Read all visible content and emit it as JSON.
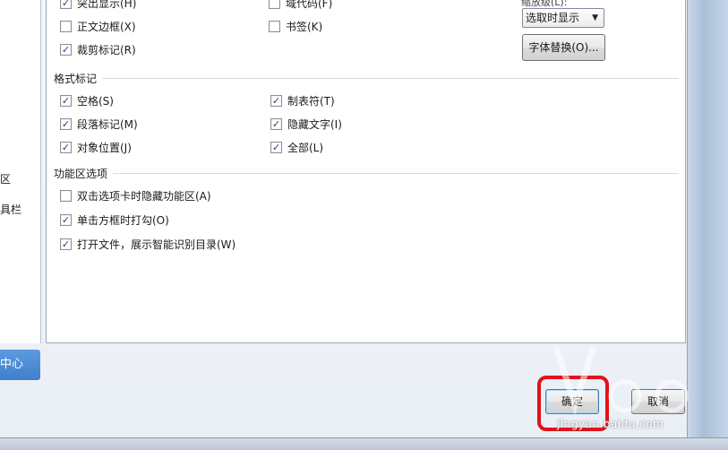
{
  "display_options": {
    "highlight": "突出显示(H)",
    "field_codes": "域代码(F)",
    "text_border": "正文边框(X)",
    "bookmarks": "书签(K)",
    "crop_marks": "裁剪标记(R)",
    "zoom_label": "缩放级(L):",
    "zoom_value": "选取时显示",
    "font_replace": "字体替换(O)..."
  },
  "format_marks": {
    "title": "格式标记",
    "spaces": "空格(S)",
    "tabs": "制表符(T)",
    "paragraph_marks": "段落标记(M)",
    "hidden_text": "隐藏文字(I)",
    "object_anchors": "对象位置(J)",
    "all": "全部(L)"
  },
  "ribbon_options": {
    "title": "功能区选项",
    "hide_on_double_click": "双击选项卡时隐藏功能区(A)",
    "click_box_check": "单击方框时打勾(O)",
    "open_file_show_toc": "打开文件，展示智能识别目录(W)"
  },
  "nav": {
    "item_a": "区",
    "item_b": "具栏",
    "center_button": "中心"
  },
  "buttons": {
    "ok": "确定",
    "cancel": "取消"
  },
  "watermark": {
    "text": "jingyan.baidu.com"
  },
  "checkboxes": {
    "highlight": true,
    "field_codes": false,
    "text_border": false,
    "bookmarks": false,
    "crop_marks": true,
    "spaces": true,
    "tabs": true,
    "paragraph_marks": true,
    "hidden_text": true,
    "object_anchors": true,
    "all": true,
    "hide_on_double_click": false,
    "click_box_check": true,
    "open_file_show_toc": true
  },
  "colors": {
    "highlight_box": "#e2121b",
    "accent": "#3f7fcc"
  }
}
